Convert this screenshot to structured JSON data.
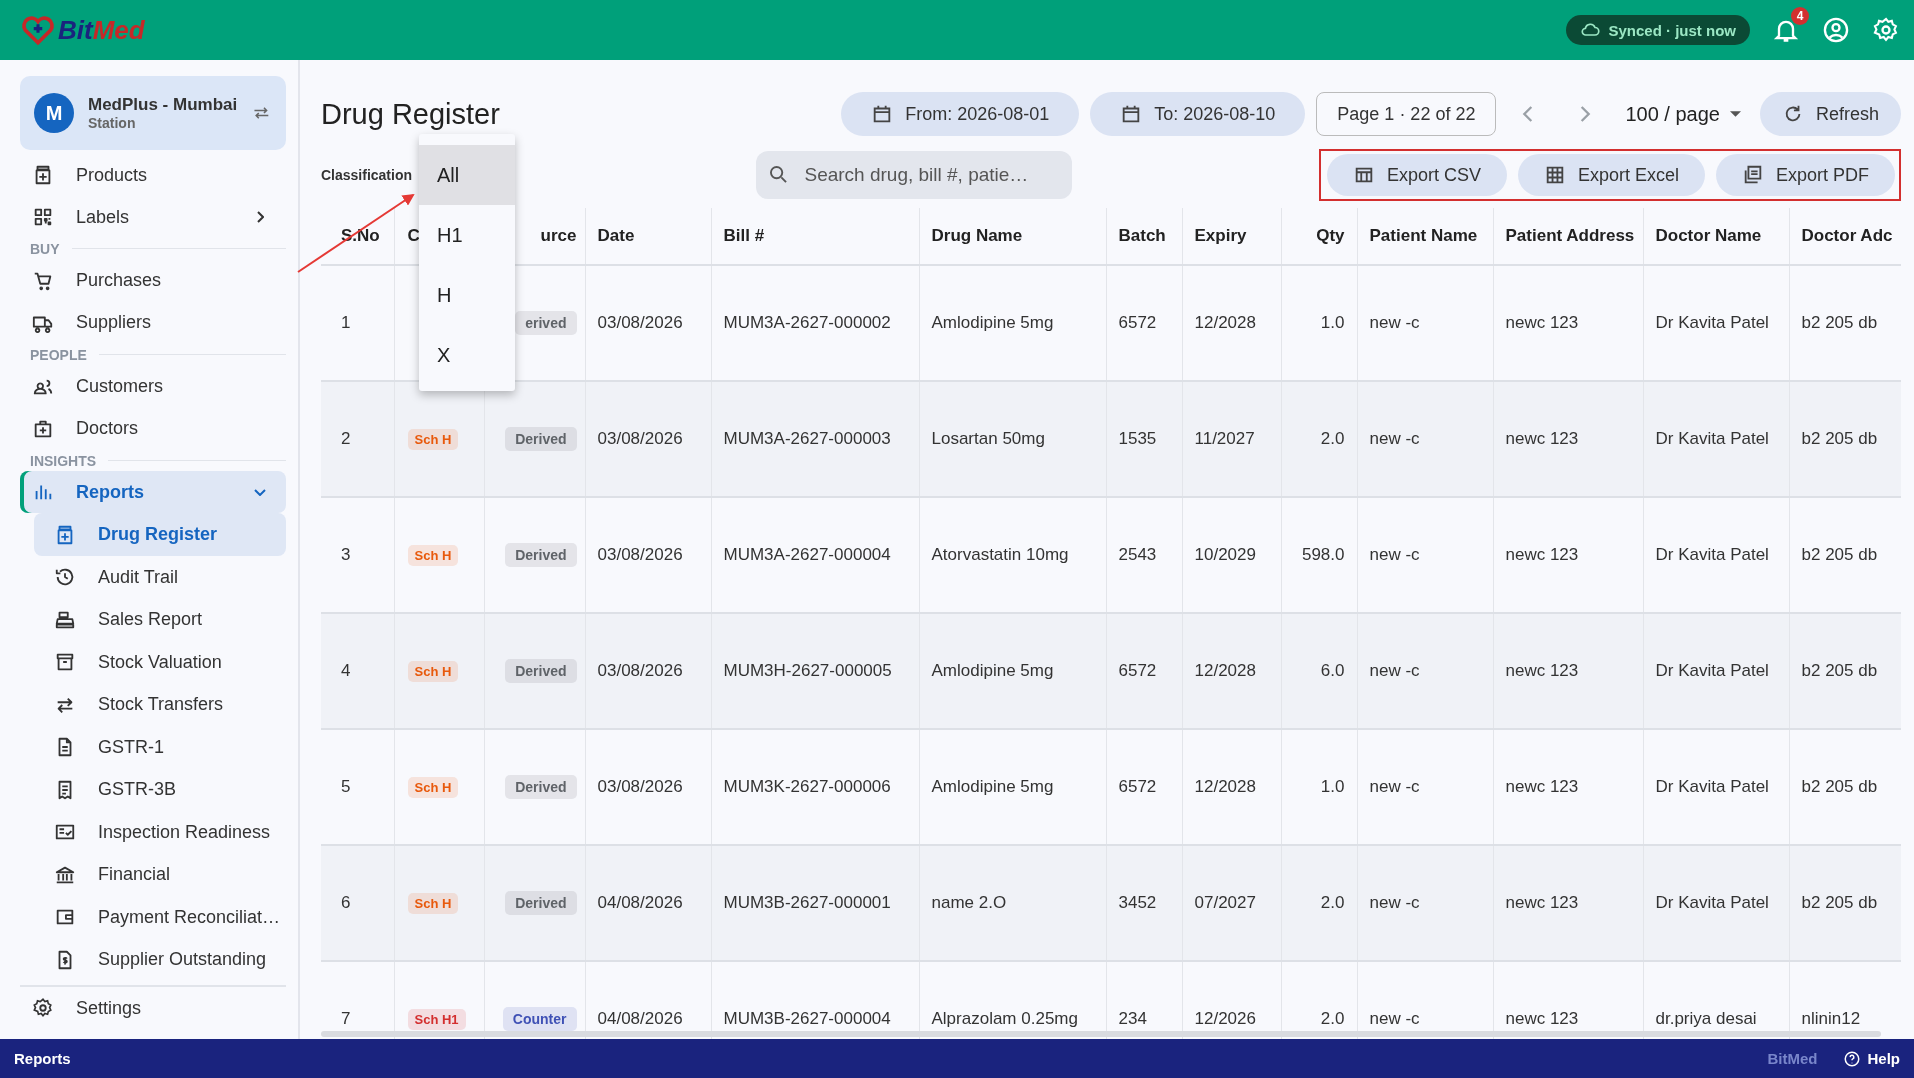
{
  "top_bar": {
    "logo": {
      "first": "Bit",
      "second": "Med"
    },
    "sync_status": "Synced · just now",
    "notification_count": "4"
  },
  "sidebar": {
    "store": {
      "initial": "M",
      "name": "MedPlus - Mumbai",
      "role": "Station"
    },
    "groups": [
      {
        "items": [
          {
            "label": "Products",
            "selected": false
          },
          {
            "label": "Labels",
            "selected": false,
            "expanded": false
          }
        ]
      },
      {
        "heading": "BUY",
        "items": [
          {
            "label": "Purchases",
            "selected": false
          },
          {
            "label": "Suppliers",
            "selected": false
          }
        ]
      },
      {
        "heading": "PEOPLE",
        "items": [
          {
            "label": "Customers",
            "selected": false
          },
          {
            "label": "Doctors",
            "selected": false
          }
        ]
      },
      {
        "heading": "INSIGHTS",
        "items": [
          {
            "label": "Reports",
            "selected": true,
            "expanded": true,
            "children": [
              {
                "label": "Drug Register",
                "selected": true
              },
              {
                "label": "Audit Trail",
                "selected": false
              },
              {
                "label": "Sales Report",
                "selected": false
              },
              {
                "label": "Stock Valuation",
                "selected": false
              },
              {
                "label": "Stock Transfers",
                "selected": false
              },
              {
                "label": "GSTR-1",
                "selected": false
              },
              {
                "label": "GSTR-3B",
                "selected": false
              },
              {
                "label": "Inspection Readiness",
                "selected": false
              },
              {
                "label": "Financial",
                "selected": false
              },
              {
                "label": "Payment Reconciliat…",
                "selected": false
              },
              {
                "label": "Supplier Outstanding",
                "selected": false
              }
            ]
          }
        ]
      }
    ],
    "footer_item": "Settings"
  },
  "page": {
    "title": "Drug Register",
    "from_date": "From: 2026-08-01",
    "to_date": "To: 2026-08-10",
    "pager": "Page 1 · 22 of 22",
    "per_page": "100 / page",
    "refresh": "Refresh",
    "classification_label": "Classification",
    "classification_options": [
      {
        "label": "All",
        "selected": true
      },
      {
        "label": "H1",
        "selected": false
      },
      {
        "label": "H",
        "selected": false
      },
      {
        "label": "X",
        "selected": false
      }
    ],
    "search": {
      "placeholder": "Search drug, bill #, patie…"
    },
    "exports": [
      "Export CSV",
      "Export Excel",
      "Export PDF"
    ]
  },
  "table": {
    "columns": [
      "S.No",
      "C",
      "urce",
      "Date",
      "Bill #",
      "Drug Name",
      "Batch",
      "Expiry",
      "Qty",
      "Patient Name",
      "Patient Address",
      "Doctor Name",
      "Doctor Adc"
    ],
    "rows": [
      {
        "sno": "1",
        "source": {
          "text": "erived",
          "color": "#5f6368"
        },
        "date": "03/08/2026",
        "bill": "MUM3A-2627-000002",
        "drug": "Amlodipine 5mg",
        "batch": "6572",
        "expiry": "12/2028",
        "qty": "1.0",
        "patient": "new -c",
        "address": "newc 123",
        "doctor": "Dr Kavita Patel",
        "doctor_address": "b2 205 db"
      },
      {
        "sno": "2",
        "class": {
          "text": "Sch H",
          "color": "#e8590c"
        },
        "source": {
          "text": "Derived",
          "color": "#5f6368"
        },
        "date": "03/08/2026",
        "bill": "MUM3A-2627-000003",
        "drug": "Losartan 50mg",
        "batch": "1535",
        "expiry": "11/2027",
        "qty": "2.0",
        "patient": "new -c",
        "address": "newc 123",
        "doctor": "Dr Kavita Patel",
        "doctor_address": "b2 205 db"
      },
      {
        "sno": "3",
        "class": {
          "text": "Sch H",
          "color": "#e8590c"
        },
        "source": {
          "text": "Derived",
          "color": "#5f6368"
        },
        "date": "03/08/2026",
        "bill": "MUM3A-2627-000004",
        "drug": "Atorvastatin 10mg",
        "batch": "2543",
        "expiry": "10/2029",
        "qty": "598.0",
        "patient": "new -c",
        "address": "newc 123",
        "doctor": "Dr Kavita Patel",
        "doctor_address": "b2 205 db"
      },
      {
        "sno": "4",
        "class": {
          "text": "Sch H",
          "color": "#e8590c"
        },
        "source": {
          "text": "Derived",
          "color": "#5f6368"
        },
        "date": "03/08/2026",
        "bill": "MUM3H-2627-000005",
        "drug": "Amlodipine 5mg",
        "batch": "6572",
        "expiry": "12/2028",
        "qty": "6.0",
        "patient": "new -c",
        "address": "newc 123",
        "doctor": "Dr Kavita Patel",
        "doctor_address": "b2 205 db"
      },
      {
        "sno": "5",
        "class": {
          "text": "Sch H",
          "color": "#e8590c"
        },
        "source": {
          "text": "Derived",
          "color": "#5f6368"
        },
        "date": "03/08/2026",
        "bill": "MUM3K-2627-000006",
        "drug": "Amlodipine 5mg",
        "batch": "6572",
        "expiry": "12/2028",
        "qty": "1.0",
        "patient": "new -c",
        "address": "newc 123",
        "doctor": "Dr Kavita Patel",
        "doctor_address": "b2 205 db"
      },
      {
        "sno": "6",
        "class": {
          "text": "Sch H",
          "color": "#e8590c"
        },
        "source": {
          "text": "Derived",
          "color": "#5f6368"
        },
        "date": "04/08/2026",
        "bill": "MUM3B-2627-000001",
        "drug": "name 2.O",
        "batch": "3452",
        "expiry": "07/2027",
        "qty": "2.0",
        "patient": "new -c",
        "address": "newc 123",
        "doctor": "Dr Kavita Patel",
        "doctor_address": "b2 205 db"
      },
      {
        "sno": "7",
        "class": {
          "text": "Sch H1",
          "color": "#d32f2f"
        },
        "source": {
          "text": "Counter",
          "color": "#3f51b5"
        },
        "date": "04/08/2026",
        "bill": "MUM3B-2627-000004",
        "drug": "Alprazolam 0.25mg",
        "batch": "234",
        "expiry": "12/2026",
        "qty": "2.0",
        "patient": "new -c",
        "address": "newc 123",
        "doctor": "dr.priya desai",
        "doctor_address": "nlinin12"
      }
    ]
  },
  "status_bar": {
    "section": "Reports",
    "brand": "BitMed",
    "help": "Help"
  }
}
